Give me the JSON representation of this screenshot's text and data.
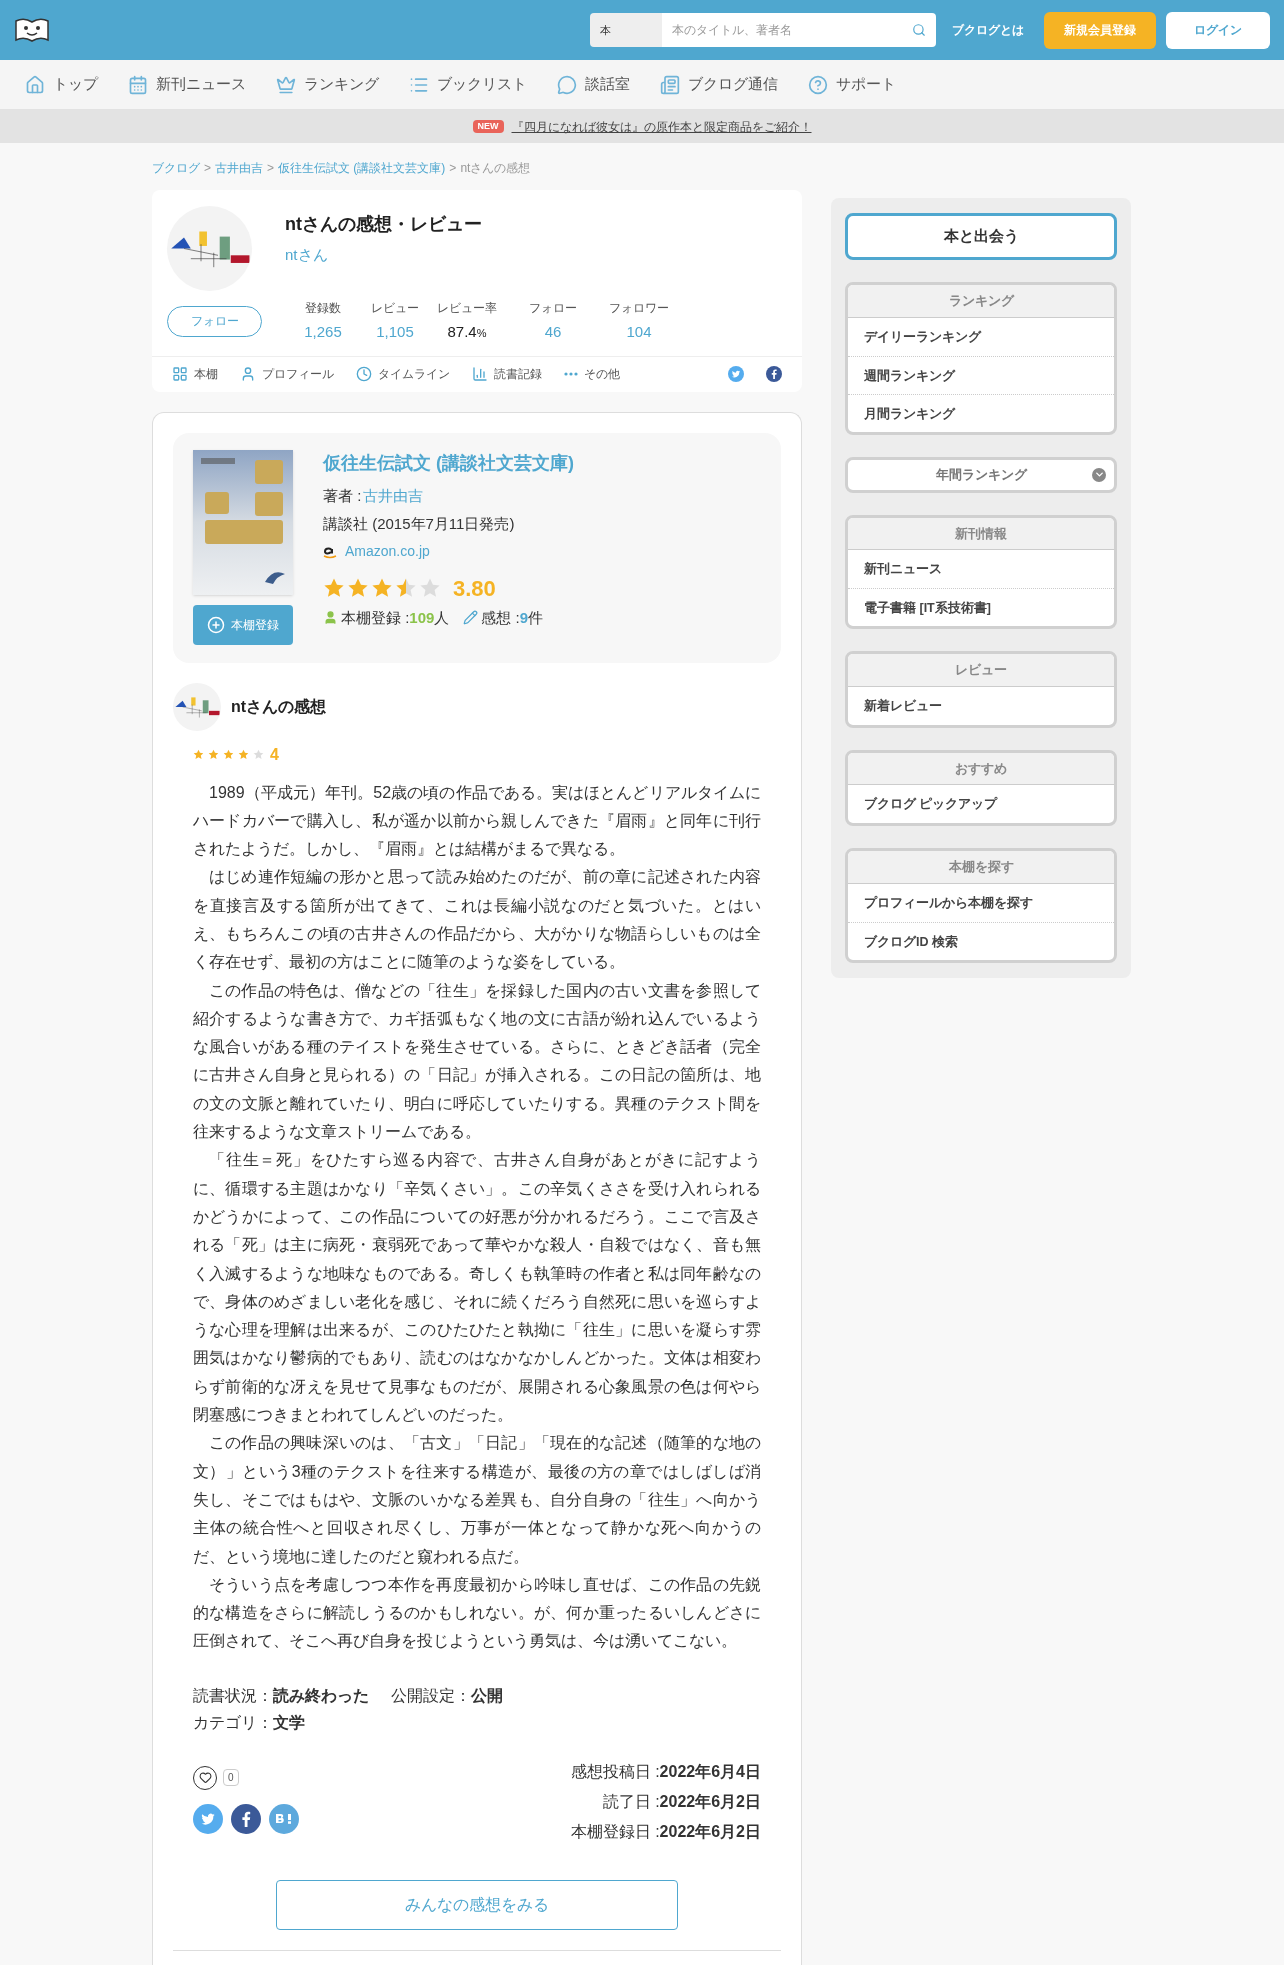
{
  "header": {
    "search_category": "本",
    "search_placeholder": "本のタイトル、著者名",
    "about_link": "ブクログとは",
    "signup_button": "新規会員登録",
    "login_button": "ログイン"
  },
  "nav": [
    {
      "label": "トップ"
    },
    {
      "label": "新刊ニュース"
    },
    {
      "label": "ランキング"
    },
    {
      "label": "ブックリスト"
    },
    {
      "label": "談話室"
    },
    {
      "label": "ブクログ通信"
    },
    {
      "label": "サポート"
    }
  ],
  "banner": {
    "badge": "NEW",
    "text": "『四月になれば彼女は』の原作本と限定商品をご紹介！"
  },
  "breadcrumb": {
    "items": [
      {
        "label": "ブクログ",
        "link": true
      },
      {
        "label": "古井由吉",
        "link": true
      },
      {
        "label": "仮往生伝試文 (講談社文芸文庫)",
        "link": true
      },
      {
        "label": "ntさんの感想",
        "link": false
      }
    ],
    "separators": [
      ">",
      ">",
      ">"
    ]
  },
  "profile": {
    "title": "ntさんの感想・レビュー",
    "name": "ntさん",
    "follow_button": "フォロー",
    "stats": [
      {
        "label": "登録数",
        "value": "1,265",
        "link": true
      },
      {
        "label": "レビュー",
        "value": "1,105",
        "link": true
      },
      {
        "label": "レビュー率",
        "value": "87.4",
        "unit": "%",
        "link": false
      },
      {
        "label": "フォロー",
        "value": "46",
        "link": true
      },
      {
        "label": "フォロワー",
        "value": "104",
        "link": true
      }
    ],
    "tabs": [
      "本棚",
      "プロフィール",
      "タイムライン",
      "読書記録",
      "その他"
    ]
  },
  "book": {
    "title": "仮往生伝試文 (講談社文芸文庫)",
    "author_label": "著者 :",
    "author": "古井由吉",
    "publisher": "講談社 (2015年7月11日発売)",
    "store": "Amazon.co.jp",
    "stars": 3.5,
    "rating": "3.80",
    "shelf_label": "本棚登録 :",
    "shelf_count": "109",
    "shelf_unit": "人",
    "review_label": "感想 :",
    "review_count": "9",
    "review_unit": "件",
    "add_button": "本棚登録"
  },
  "review": {
    "heading": "ntさんの感想",
    "stars": 4,
    "rating": "4",
    "paragraphs": [
      "1989（平成元）年刊。52歳の頃の作品である。実はほとんどリアルタイムにハードカバーで購入し、私が遥か以前から親しんできた『眉雨』と同年に刊行されたようだ。しかし、『眉雨』とは結構がまるで異なる。",
      "はじめ連作短編の形かと思って読み始めたのだが、前の章に記述された内容を直接言及する箇所が出てきて、これは長編小説なのだと気づいた。とはいえ、もちろんこの頃の古井さんの作品だから、大がかりな物語らしいものは全く存在せず、最初の方はことに随筆のような姿をしている。",
      "この作品の特色は、僧などの「往生」を採録した国内の古い文書を参照して紹介するような書き方で、カギ括弧もなく地の文に古語が紛れ込んでいるような風合いがある種のテイストを発生させている。さらに、ときどき話者（完全に古井さん自身と見られる）の「日記」が挿入される。この日記の箇所は、地の文の文脈と離れていたり、明白に呼応していたりする。異種のテクスト間を往来するような文章ストリームである。",
      "「往生＝死」をひたすら巡る内容で、古井さん自身があとがきに記すように、循環する主題はかなり「辛気くさい」。この辛気くささを受け入れられるかどうかによって、この作品についての好悪が分かれるだろう。ここで言及される「死」は主に病死・衰弱死であって華やかな殺人・自殺ではなく、音も無く入滅するような地味なものである。奇しくも執筆時の作者と私は同年齢なので、身体のめざましい老化を感じ、それに続くだろう自然死に思いを巡らすような心理を理解は出来るが、このひたひたと執拗に「往生」に思いを凝らす雰囲気はかなり鬱病的でもあり、読むのはなかなかしんどかった。文体は相変わらず前衛的な冴えを見せて見事なものだが、展開される心象風景の色は何やら閉塞感につきまとわれてしんどいのだった。",
      "この作品の興味深いのは、「古文」「日記」「現在的な記述（随筆的な地の文）」という3種のテクストを往来する構造が、最後の方の章ではしばしば消失し、そこではもはや、文脈のいかなる差異も、自分自身の「往生」へ向かう主体の統合性へと回収され尽くし、万事が一体となって静かな死へ向かうのだ、という境地に達したのだと窺われる点だ。",
      "そういう点を考慮しつつ本作を再度最初から吟味し直せば、この作品の先鋭的な構造をさらに解読しうるのかもしれない。が、何か重ったるいしんどさに圧倒されて、そこへ再び自身を投じようという勇気は、今は湧いてこない。"
    ],
    "status": [
      {
        "label": "読書状況：",
        "value": "読み終わった"
      },
      {
        "label": "公開設定：",
        "value": "公開"
      }
    ],
    "category": {
      "label": "カテゴリ：",
      "value": "文学"
    },
    "like_count": "0",
    "dates": [
      {
        "label": "感想投稿日 :",
        "value": "2022年6月4日"
      },
      {
        "label": "読了日 :",
        "value": "2022年6月2日"
      },
      {
        "label": "本棚登録日 :",
        "value": "2022年6月2日"
      }
    ],
    "more_button": "みんなの感想をみる"
  },
  "sidebar": {
    "main_button": "本と出会う",
    "sections": [
      {
        "kind": "list",
        "title": "ランキング",
        "items": [
          "デイリーランキング",
          "週間ランキング",
          "月間ランキング"
        ]
      },
      {
        "kind": "dropdown",
        "title": "年間ランキング"
      },
      {
        "kind": "list",
        "title": "新刊情報",
        "items": [
          "新刊ニュース",
          "電子書籍 [IT系技術書]"
        ]
      },
      {
        "kind": "list",
        "title": "レビュー",
        "items": [
          "新着レビュー"
        ]
      },
      {
        "kind": "list",
        "title": "おすすめ",
        "items": [
          "ブクログ ピックアップ"
        ]
      },
      {
        "kind": "list",
        "title": "本棚を探す",
        "items": [
          "プロフィールから本棚を探す",
          "ブクログID 検索"
        ]
      }
    ]
  }
}
